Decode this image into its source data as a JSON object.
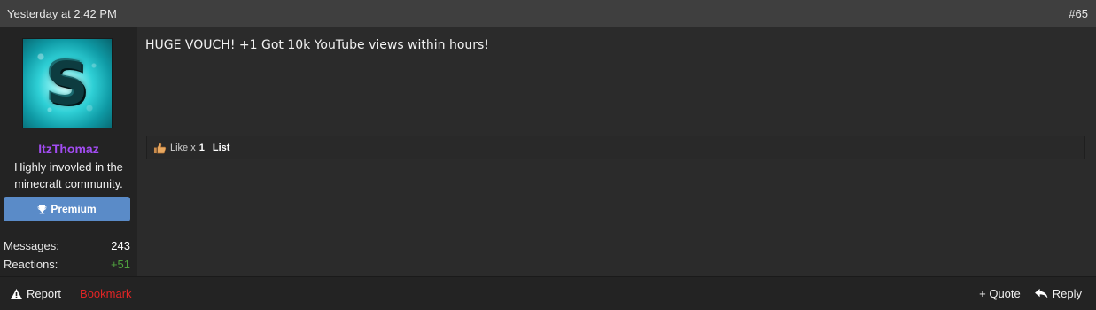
{
  "header": {
    "timestamp": "Yesterday at 2:42 PM",
    "post_number": "#65"
  },
  "user": {
    "avatar_letter": "S",
    "username": "ItzThomaz",
    "title_line1": "Highly invovled in the",
    "title_line2": "minecraft community.",
    "banner_label": "Premium",
    "stats": {
      "messages_label": "Messages:",
      "messages_value": "243",
      "reactions_label": "Reactions:",
      "reactions_value": "+51"
    }
  },
  "post": {
    "body": "HUGE VOUCH! +1 Got 10k YouTube views within hours!"
  },
  "reactions": {
    "like_text": "Like x",
    "like_count": "1",
    "list_label": "List"
  },
  "footer": {
    "report_label": "Report",
    "bookmark_label": "Bookmark",
    "quote_label": "+ Quote",
    "reply_label": "Reply"
  },
  "colors": {
    "username": "#a24cf2",
    "banner": "#5a8bc8",
    "bookmark": "#e02525",
    "reaction_positive": "#4fa13e",
    "header_bg": "#3f3f3f"
  },
  "icons": {
    "banner": "trophy-icon",
    "like": "thumbs-up-icon",
    "report": "warning-icon",
    "reply": "reply-arrow-icon"
  }
}
